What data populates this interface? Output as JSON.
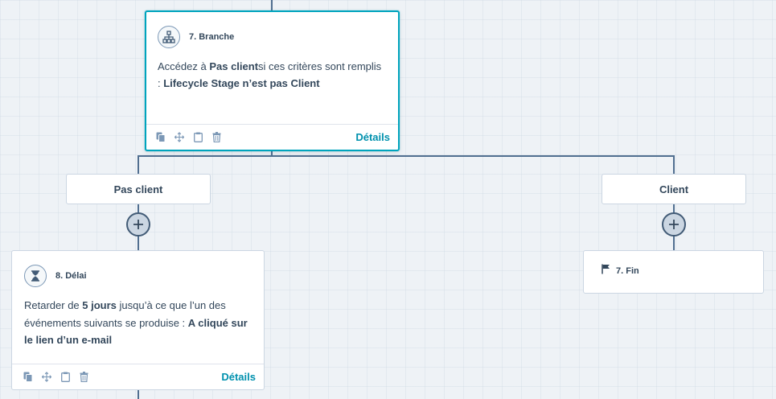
{
  "branch_card": {
    "title": "7. Branche",
    "icon": "branch-icon",
    "text_prefix": "Accédez à ",
    "target_branch": "Pas client",
    "text_middle": "si ces critères sont remplis : ",
    "criteria": "Lifecycle Stage n’est pas Client",
    "details_label": "Détails"
  },
  "branches": {
    "left_label": "Pas client",
    "right_label": "Client"
  },
  "delay_card": {
    "title": "8. Délai",
    "icon": "hourglass-icon",
    "text_prefix": "Retarder de ",
    "duration": "5 jours",
    "text_middle": " jusqu’à ce que l’un des événements suivants se produise : ",
    "event": "A cliqué sur le lien d’un e-mail",
    "details_label": "Détails"
  },
  "end_card": {
    "title": "7. Fin",
    "icon": "flag-icon"
  },
  "footer_actions": [
    "copy-icon",
    "move-icon",
    "clipboard-icon",
    "trash-icon"
  ],
  "colors": {
    "accent": "#00a4bd",
    "link": "#0091ae",
    "text": "#33475b",
    "connector": "#516f90",
    "canvas": "#eef2f6"
  }
}
